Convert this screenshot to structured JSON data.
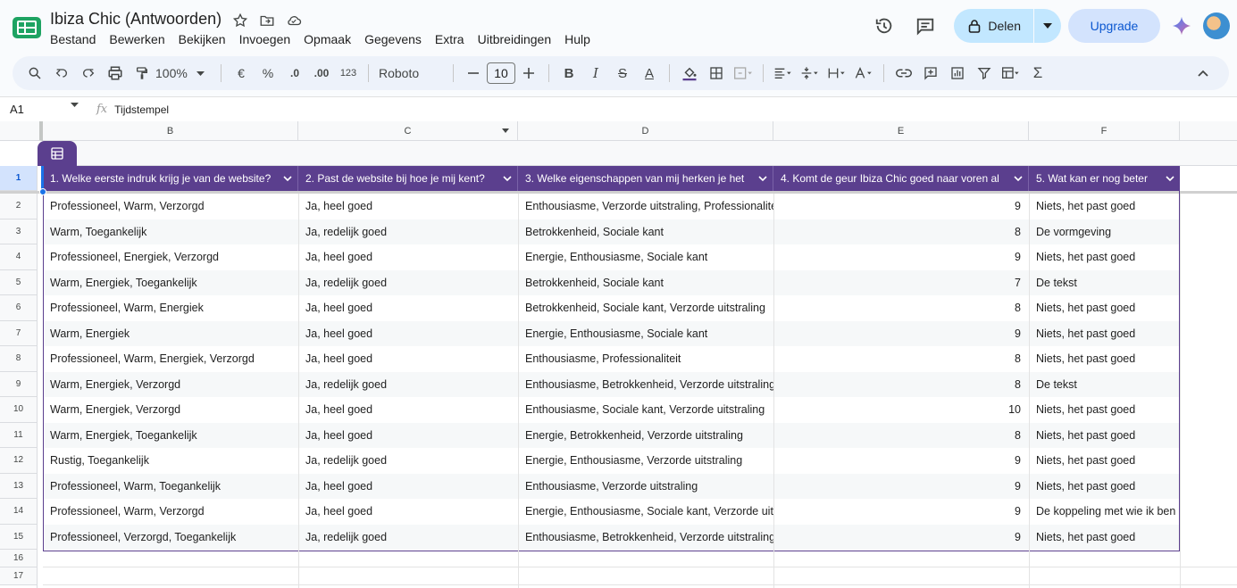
{
  "app": {
    "title": "Ibiza Chic (Antwoorden)",
    "menu": [
      "Bestand",
      "Bewerken",
      "Bekijken",
      "Invoegen",
      "Opmaak",
      "Gegevens",
      "Extra",
      "Uitbreidingen",
      "Hulp"
    ],
    "share_label": "Delen",
    "upgrade_label": "Upgrade"
  },
  "toolbar": {
    "zoom": "100%",
    "currency": "€",
    "percent": "%",
    "dec_less": ".0",
    "dec_more": ".00",
    "format_123": "123",
    "font": "Roboto",
    "font_size": "10"
  },
  "formula_bar": {
    "cell_ref": "A1",
    "fx": "fx",
    "content": "Tijdstempel"
  },
  "columns": [
    "B",
    "C",
    "D",
    "E",
    "F"
  ],
  "row_numbers": [
    "1",
    "2",
    "3",
    "4",
    "5",
    "6",
    "7",
    "8",
    "9",
    "10",
    "11",
    "12",
    "13",
    "14",
    "15",
    "16",
    "17"
  ],
  "headers": [
    "1. Welke eerste indruk krijg je van de website?",
    "2. Past de website bij hoe je mij kent?",
    "3. Welke eigenschappen van mij herken je het",
    "4. Komt de geur Ibiza Chic goed naar voren al",
    "5. Wat kan er nog beter"
  ],
  "rows": [
    [
      "Professioneel, Warm, Verzorgd",
      "Ja, heel goed",
      "Enthousiasme, Verzorde uitstraling, Professionaliteit",
      "9",
      "Niets, het past goed"
    ],
    [
      "Warm, Toegankelijk",
      "Ja, redelijk goed",
      "Betrokkenheid, Sociale kant",
      "8",
      "De vormgeving"
    ],
    [
      "Professioneel, Energiek, Verzorgd",
      "Ja, heel goed",
      "Energie, Enthousiasme, Sociale kant",
      "9",
      "Niets, het past goed"
    ],
    [
      "Warm, Energiek, Toegankelijk",
      "Ja, redelijk goed",
      "Betrokkenheid, Sociale kant",
      "7",
      "De tekst"
    ],
    [
      "Professioneel, Warm, Energiek",
      "Ja, heel goed",
      "Betrokkenheid, Sociale kant, Verzorde uitstraling",
      "8",
      "Niets, het past goed"
    ],
    [
      "Warm, Energiek",
      "Ja, heel goed",
      "Energie, Enthousiasme, Sociale kant",
      "9",
      "Niets, het past goed"
    ],
    [
      "Professioneel, Warm, Energiek, Verzorgd",
      "Ja, heel goed",
      "Enthousiasme, Professionaliteit",
      "8",
      "Niets, het past goed"
    ],
    [
      "Warm, Energiek, Verzorgd",
      "Ja, redelijk goed",
      "Enthousiasme, Betrokkenheid, Verzorde uitstraling",
      "8",
      "De tekst"
    ],
    [
      "Warm, Energiek, Verzorgd",
      "Ja, heel goed",
      "Enthousiasme, Sociale kant, Verzorde uitstraling",
      "10",
      "Niets, het past goed"
    ],
    [
      "Warm, Energiek, Toegankelijk",
      "Ja, heel goed",
      "Energie, Betrokkenheid, Verzorde uitstraling",
      "8",
      "Niets, het past goed"
    ],
    [
      "Rustig, Toegankelijk",
      "Ja, redelijk goed",
      "Energie, Enthousiasme, Verzorde uitstraling",
      "9",
      "Niets, het past goed"
    ],
    [
      "Professioneel, Warm, Toegankelijk",
      "Ja, heel goed",
      "Enthousiasme, Verzorde uitstraling",
      "9",
      "Niets, het past goed"
    ],
    [
      "Professioneel, Warm, Verzorgd",
      "Ja, heel goed",
      "Energie, Enthousiasme, Sociale kant, Verzorde uitstraling",
      "9",
      "De koppeling met wie ik ben"
    ],
    [
      "Professioneel, Verzorgd, Toegankelijk",
      "Ja, redelijk goed",
      "Enthousiasme, Betrokkenheid, Verzorde uitstraling",
      "9",
      "Niets, het past goed"
    ]
  ],
  "colors": {
    "header_bg": "#5b3f8e",
    "accent": "#0b57d0",
    "share_bg": "#c2e7ff"
  }
}
